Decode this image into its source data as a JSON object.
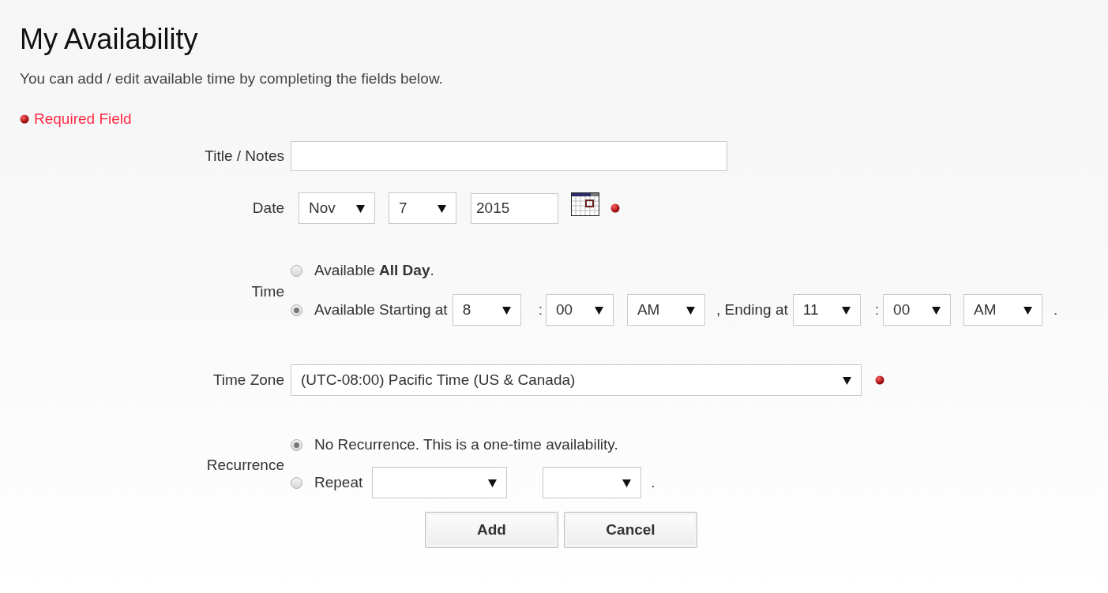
{
  "page": {
    "title": "My Availability",
    "intro": "You can add / edit available time by completing the fields below.",
    "required_legend": "Required Field"
  },
  "form": {
    "title_notes": {
      "label": "Title / Notes"
    },
    "date": {
      "label": "Date",
      "month": "Nov",
      "day": "7",
      "year": "2015",
      "required": true
    },
    "time": {
      "label": "Time",
      "options": [
        {
          "kind": "all_day",
          "text": "Available **All Day**.",
          "selected": false
        },
        {
          "kind": "range",
          "text": "Available Starting at",
          "selected": true,
          "start_hour": "8",
          "start_separator": ":",
          "start_minute": "00",
          "start_period": "AM",
          "end_label": ", Ending at",
          "end_hour": "11",
          "end_separator": ":",
          "end_minute": "00",
          "end_period": "AM",
          "end_mark": "."
        }
      ]
    },
    "time_zone": {
      "label": "Time Zone",
      "value": "(UTC-08:00) Pacific Time (US & Canada)",
      "required": true
    },
    "recurrence": {
      "label": "Recurrence",
      "options": [
        {
          "kind": "none",
          "text": "No Recurrence. This is a one-time availability.",
          "selected": true
        },
        {
          "kind": "repeat",
          "text": "Repeat",
          "selected": false,
          "end_mark": "."
        }
      ]
    }
  },
  "buttons": [
    "Add",
    "Cancel"
  ]
}
